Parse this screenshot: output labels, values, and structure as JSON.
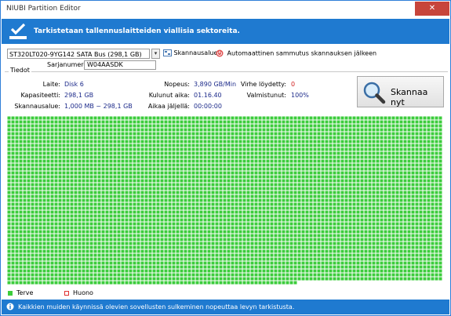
{
  "window": {
    "title": "NIUBI Partition Editor",
    "close_icon": "close-icon"
  },
  "header": {
    "text": "Tarkistetaan tallennuslaitteiden viallisia sektoreita.",
    "icon": "checklist-icon"
  },
  "toolbar": {
    "disk_select": "ST320LT020-9YG142 SATA Bus (298,1 GB)",
    "scan_area_label": "Skannausalue",
    "auto_shutdown_label": "Automaattinen sammutus skannauksen jälkeen"
  },
  "serial": {
    "label": "Sarjanumero:",
    "value": "W04AASDK"
  },
  "info": {
    "group_label": "Tiedot",
    "device_label": "Laite:",
    "device_value": "Disk 6",
    "capacity_label": "Kapasiteetti:",
    "capacity_value": "298,1 GB",
    "scanarea_label": "Skannausalue:",
    "scanarea_value": "1,000 MB ~ 298,1 GB",
    "speed_label": "Nopeus:",
    "speed_value": "3,890 GB/Min",
    "elapsed_label": "Kulunut aika:",
    "elapsed_value": "01.16.40",
    "remaining_label": "Aikaa jäljellä:",
    "remaining_value": "00:00:00",
    "errors_label": "Virhe löydetty:",
    "errors_value": "0",
    "completed_label": "Valmistunut:",
    "completed_value": "100%"
  },
  "scan_button": {
    "label": "Skannaa nyt"
  },
  "legend": {
    "healthy": "Terve",
    "bad": "Huono"
  },
  "colors": {
    "accent": "#1f7ad0",
    "healthy": "#3ccc3c",
    "bad": "#e03030",
    "value_text": "#1c2a8a"
  },
  "status": {
    "text": "Kaikkien muiden käynnissä olevien sovellusten sulkeminen nopeuttaa levyn tarkistusta."
  }
}
